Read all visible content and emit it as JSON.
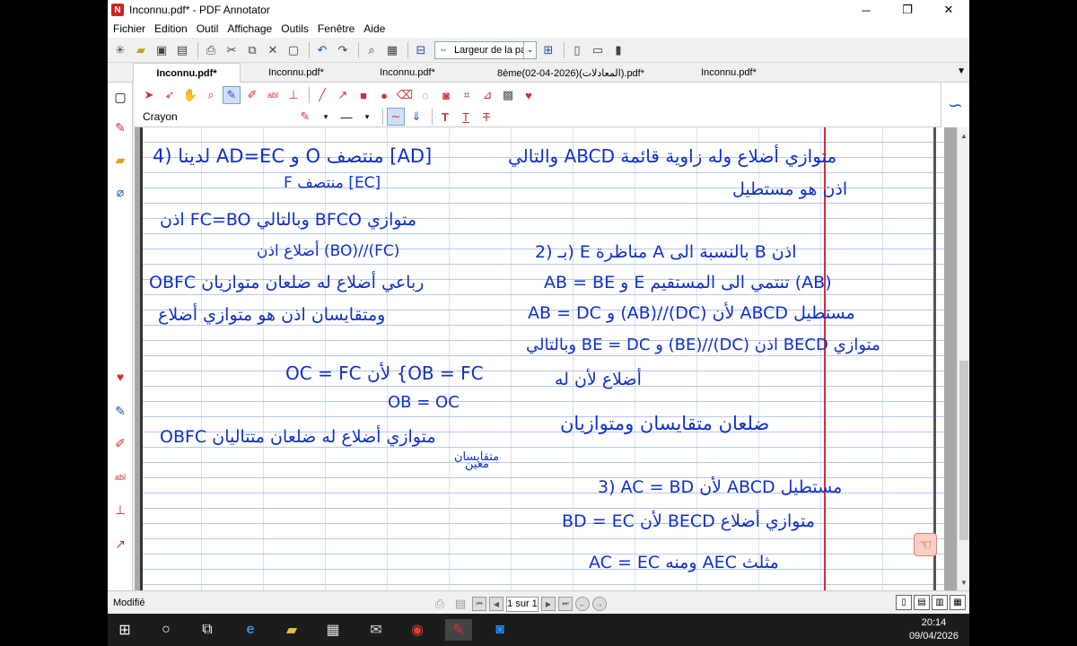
{
  "window": {
    "title": "Inconnu.pdf* - PDF Annotator",
    "logo_letter": "N",
    "controls": {
      "minimize": "─",
      "restore": "❐",
      "close": "✕"
    }
  },
  "menu": [
    "Fichier",
    "Edition",
    "Outil",
    "Affichage",
    "Outils",
    "Fenêtre",
    "Aide"
  ],
  "toolbar": {
    "zoom_value": "Largeur de la pa",
    "zoom_arrow": "⌄"
  },
  "tabs": [
    {
      "label": "Inconnu.pdf*"
    },
    {
      "label": "Inconnu.pdf*"
    },
    {
      "label": "Inconnu.pdf*"
    },
    {
      "label": "8ème(02-04-2026)(المعادلات).pdf*"
    },
    {
      "label": "Inconnu.pdf*"
    }
  ],
  "tab_dropdown": "▼",
  "annotation_toolbar": {
    "tool_label": "Crayon",
    "text_tools": [
      "T",
      "T",
      "T"
    ]
  },
  "document": {
    "left_column": [
      "4) لدينا AD=EC و O منتصف [AD]",
      "F منتصف [EC]",
      "اذن FC=BO وبالتالي BFCO متوازي",
      "أضلاع اذن (BO)//(FC)",
      "OBFC رباعي أضلاع له ضلعان متوازيان",
      "ومتقايسان اذن هو متوازي أضلاع",
      "OC = FC لأن {OB = FC",
      "OB = OC",
      "OBFC متوازي أضلاع له ضلعان متتاليان",
      "متقايسان",
      "معين"
    ],
    "right_column": [
      "والتالي ABCD متوازي أضلاع وله زاوية قائمة",
      "اذن هو مستطيل",
      "2) بـ) E مناظرة A بالنسبة الى B اذن",
      "AB = BE و E تنتمي الى المستقيم (AB)",
      "AB = DC و (AB)//(DC) لأن ABCD مستطيل",
      "وبالتالي BE = DC و (BE)//(DC) اذن BECD متوازي",
      "أضلاع لأن له",
      "ضلعان متقايسان ومتوازيان",
      "3) AC = BD لأن ABCD مستطيل",
      "BD = EC لأن BECD متوازي أضلاع",
      "AC = EC ومنه AEC مثلث"
    ]
  },
  "status": {
    "text": "Modifié",
    "page_indicator": "1 sur 1"
  },
  "taskbar": {
    "time": "20:14",
    "date": "09/04/2026"
  },
  "colors": {
    "ink": "#1030c8",
    "margin_line": "#d03030",
    "accent": "#2060c0"
  }
}
